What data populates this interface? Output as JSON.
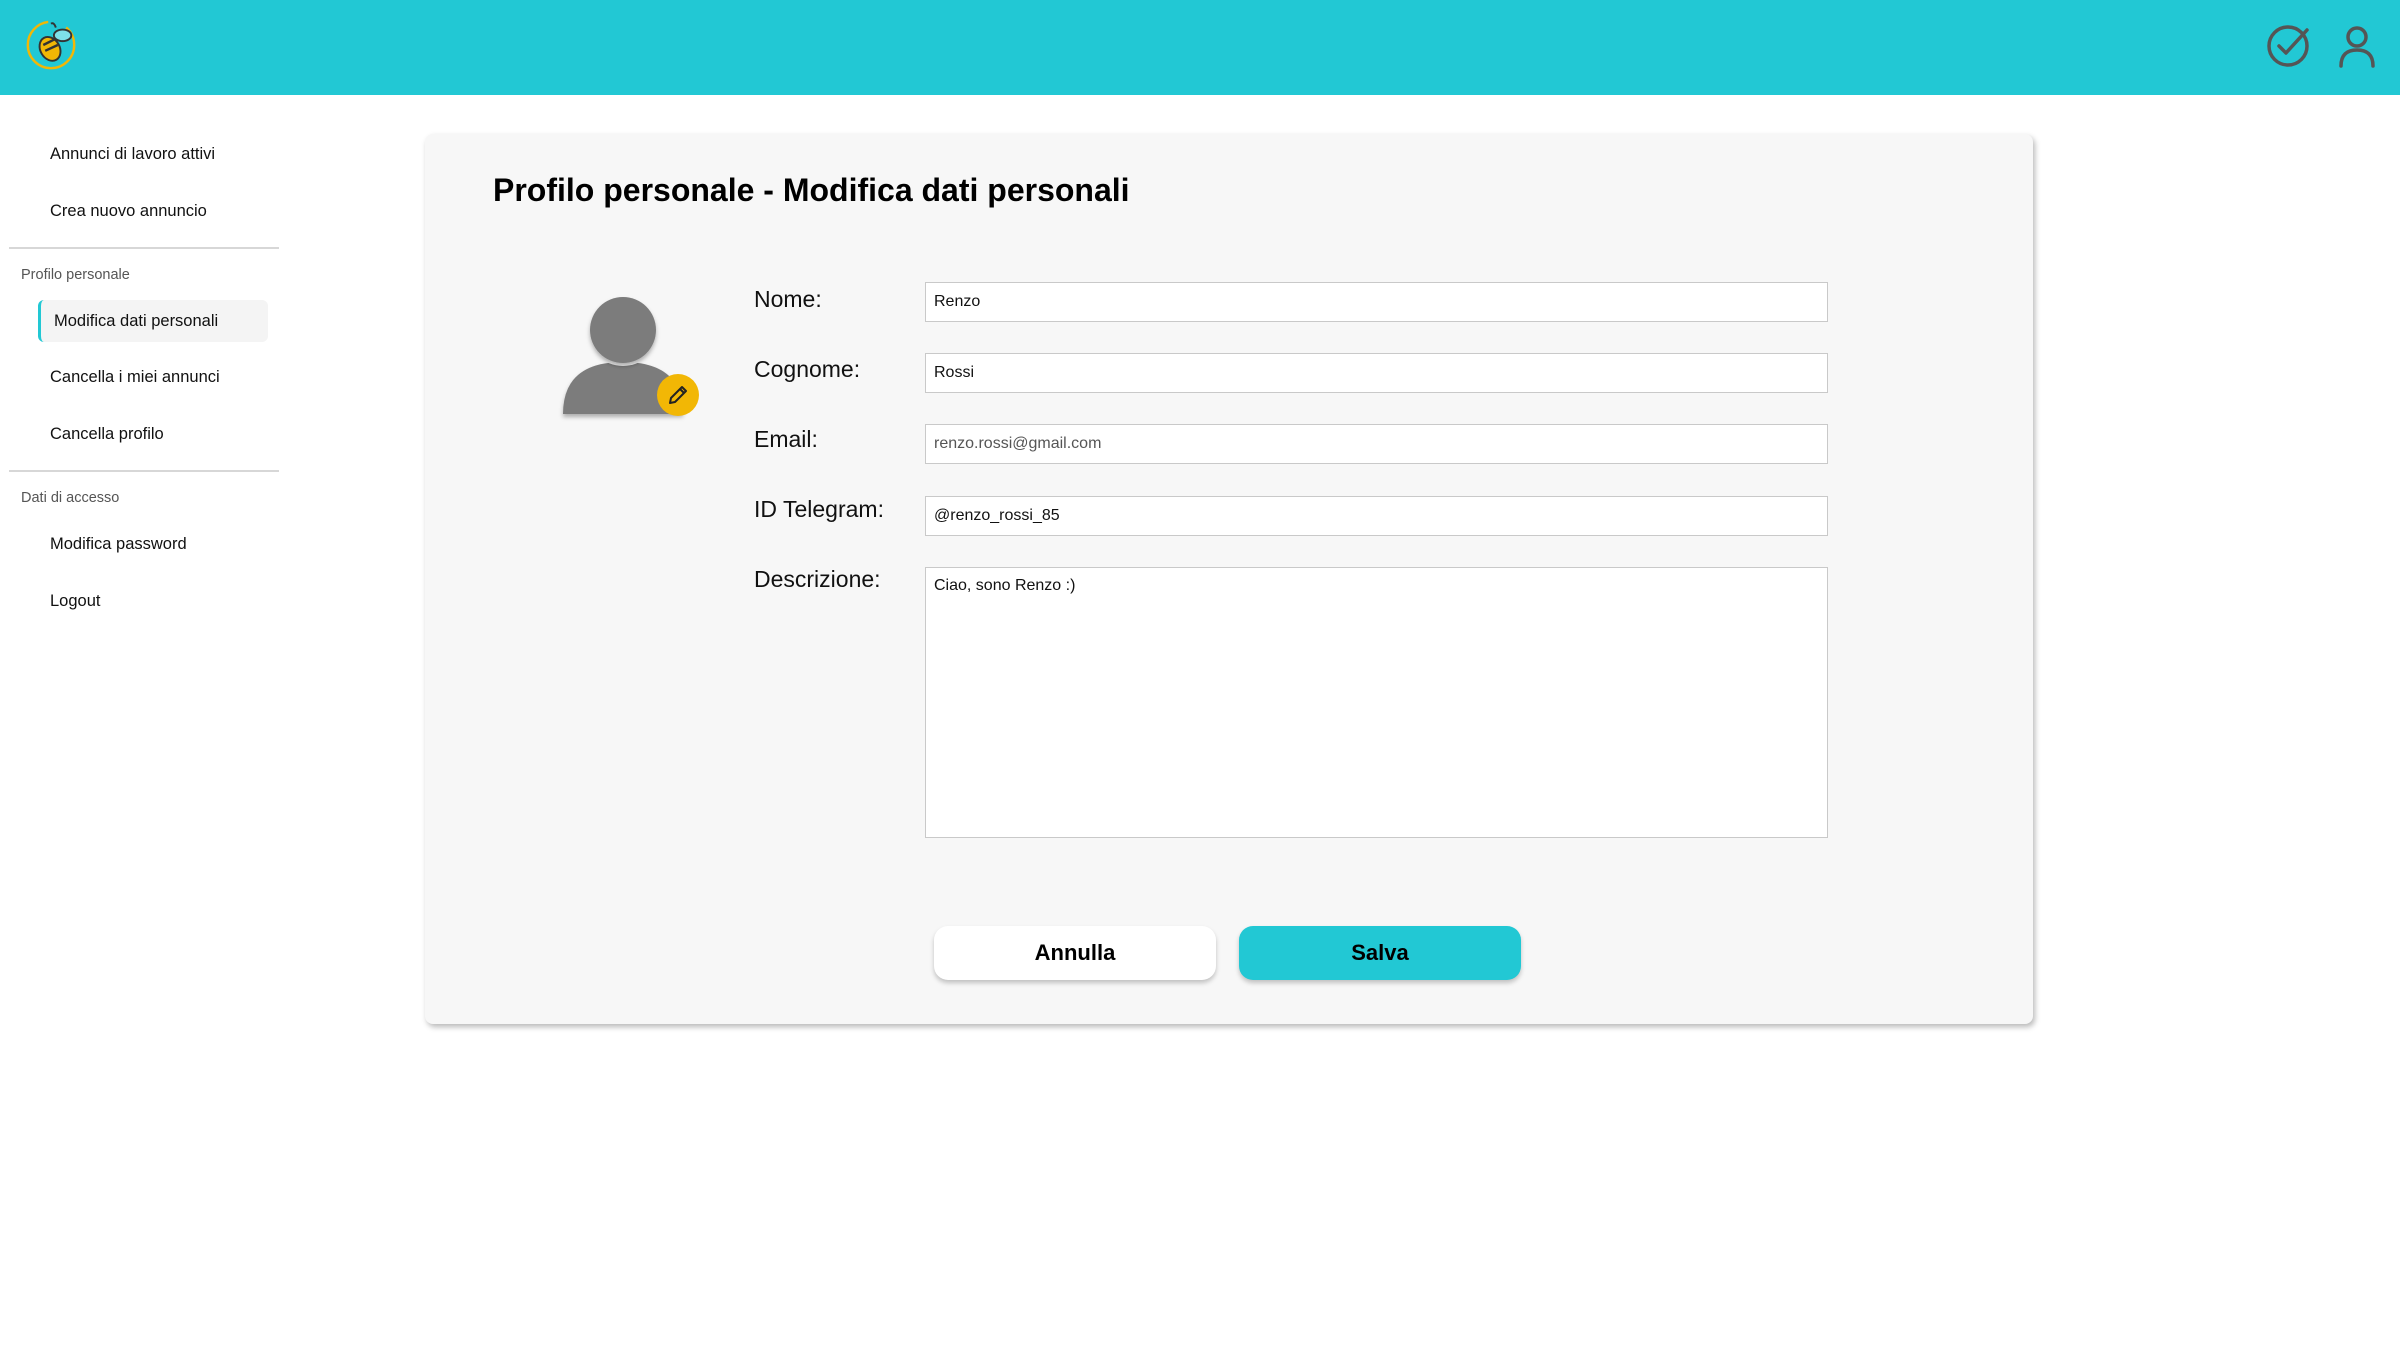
{
  "header": {
    "logo_icon": "bee-logo-icon",
    "actions": [
      {
        "name": "check-circle-icon"
      },
      {
        "name": "user-icon"
      }
    ],
    "accent_color": "#22c8d4"
  },
  "sidebar": {
    "items": [
      {
        "label": "Annunci di lavoro attivi"
      },
      {
        "label": "Crea nuovo annuncio"
      }
    ],
    "section_profile": {
      "title": "Profilo personale",
      "items": [
        {
          "label": "Modifica dati personali",
          "active": true
        },
        {
          "label": "Cancella i miei annunci"
        },
        {
          "label": "Cancella profilo"
        }
      ]
    },
    "section_access": {
      "title": "Dati di accesso",
      "items": [
        {
          "label": "Modifica password"
        },
        {
          "label": "Logout"
        }
      ]
    }
  },
  "main": {
    "title": "Profilo personale - Modifica dati personali",
    "avatar_icon": "avatar-icon",
    "edit_icon": "pencil-icon",
    "edit_color": "#f2b705",
    "fields": {
      "nome": {
        "label": "Nome:",
        "value": "Renzo"
      },
      "cognome": {
        "label": "Cognome:",
        "value": "Rossi"
      },
      "email": {
        "label": "Email:",
        "value": "renzo.rossi@gmail.com"
      },
      "telegram": {
        "label": "ID Telegram:",
        "value": "@renzo_rossi_85"
      },
      "descrizione": {
        "label": "Descrizione:",
        "value": "Ciao, sono Renzo :)"
      }
    },
    "buttons": {
      "cancel": "Annulla",
      "save": "Salva"
    }
  }
}
